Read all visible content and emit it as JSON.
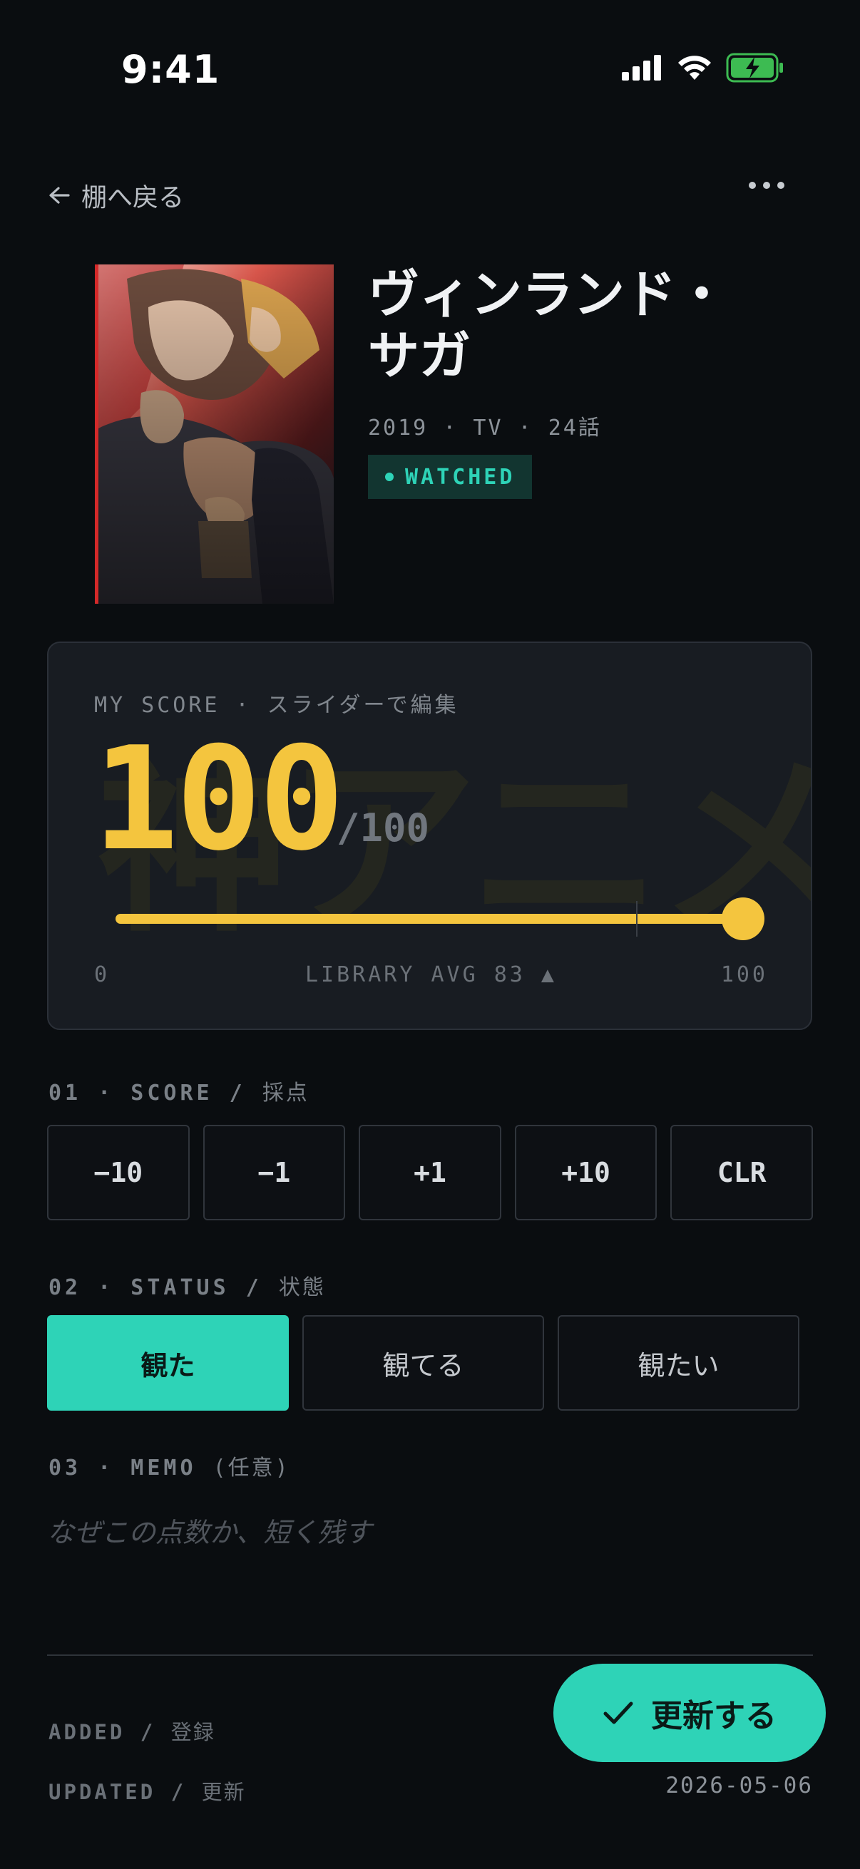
{
  "status_bar": {
    "time": "9:41"
  },
  "nav": {
    "back_label": "棚へ戻る"
  },
  "anime": {
    "title": "ヴィンランド・サガ",
    "meta": "2019 · TV · 24話",
    "badge": "WATCHED"
  },
  "score_card": {
    "label": "MY SCORE · スライダーで編集",
    "watermark": "神アニメ",
    "score": "100",
    "score_value": 100,
    "max_label": "/100",
    "min": "0",
    "max": "100",
    "avg_label": "LIBRARY AVG 83 ▲",
    "avg_value": 83
  },
  "sections": {
    "score": {
      "label": "01 · SCORE / ",
      "label_jp": "採点"
    },
    "status": {
      "label": "02 · STATUS / ",
      "label_jp": "状態"
    },
    "memo": {
      "label": "03 · MEMO ",
      "label_jp": "(任意)"
    }
  },
  "score_buttons": [
    "−10",
    "−1",
    "+1",
    "+10",
    "CLR"
  ],
  "status_buttons": [
    "観た",
    "観てる",
    "観たい"
  ],
  "memo": {
    "placeholder": "なぜこの点数か、短く残す"
  },
  "info": {
    "added_label": "ADDED / ",
    "added_label_jp": "登録",
    "updated_label": "UPDATED / ",
    "updated_label_jp": "更新",
    "updated_value": "2026-05-06"
  },
  "actions": {
    "update_label": "更新する"
  },
  "colors": {
    "accent": "#2ed3b7",
    "score": "#f4c53e",
    "background": "#0a0d10",
    "card": "#181c22"
  }
}
